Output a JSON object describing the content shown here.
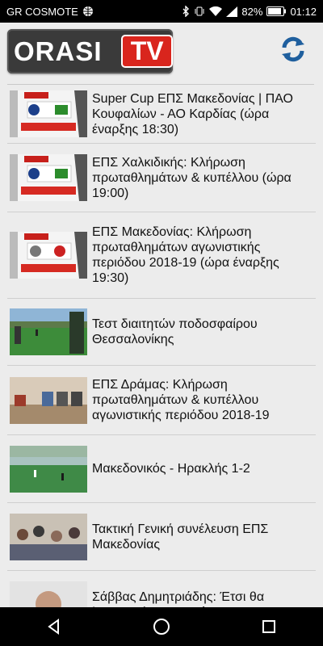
{
  "status": {
    "carrier": "GR COSMOTE",
    "battery": "82%",
    "time": "01:12"
  },
  "app": {
    "logo_main": "ORASI",
    "logo_tv": "TV",
    "refresh_icon": "refresh-icon"
  },
  "articles": [
    {
      "title": "Super Cup ΕΠΣ Μακεδονίας | ΠΑΟ Κουφαλίων - ΑΟ Καρδίας (ώρα έναρξης 18:30)"
    },
    {
      "title": "ΕΠΣ Χαλκιδικής: Κλήρωση πρωταθλημάτων & κυπέλλου (ώρα 19:00)"
    },
    {
      "title": "ΕΠΣ Μακεδονίας: Κλήρωση πρωταθλημάτων αγωνιστικής περιόδου 2018-19 (ώρα έναρξης 19:30)"
    },
    {
      "title": "Τεστ διαιτητών ποδοσφαίρου Θεσσαλονίκης"
    },
    {
      "title": "ΕΠΣ Δράμας: Κλήρωση πρωταθλημάτων & κυπέλλου αγωνιστικής περιόδου 2018-19"
    },
    {
      "title": "Μακεδονικός - Ηρακλής 1-2"
    },
    {
      "title": "Τακτική Γενική συνέλευση ΕΠΣ Μακεδονίας"
    },
    {
      "title": "Σάββας Δημητριάδης: Έτσι θα λειτουργήσει το πρόγραμμα"
    }
  ],
  "colors": {
    "brand_red": "#d9251d",
    "refresh_blue": "#1f5f9e"
  }
}
